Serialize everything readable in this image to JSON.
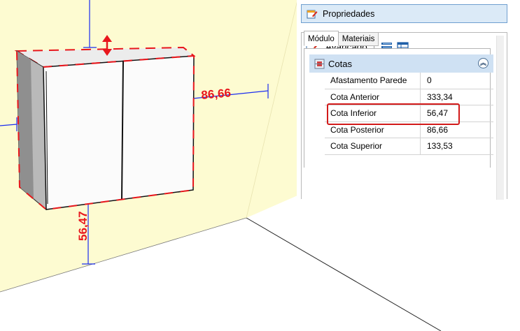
{
  "viewport": {
    "dimensions": {
      "right": "86,66",
      "bottom": "56,47"
    },
    "colors": {
      "wall": "#fdfbd1",
      "dimension_red": "#e8161c",
      "dimension_blue": "#1a2cf0"
    }
  },
  "panel": {
    "header_title": "Propriedades",
    "header_icon": "properties-icon",
    "advanced_label": "Avançado",
    "tabs": [
      {
        "label": "Módulo",
        "active": true
      },
      {
        "label": "Materiais",
        "active": false
      }
    ],
    "group": {
      "label": "Cotas",
      "collapse_glyph": "︽"
    },
    "rows": [
      {
        "name": "Afastamento Parede",
        "value": "0",
        "highlighted": true
      },
      {
        "name": "Cota Anterior",
        "value": "333,34"
      },
      {
        "name": "Cota Inferior",
        "value": "56,47"
      },
      {
        "name": "Cota Posterior",
        "value": "86,66"
      },
      {
        "name": "Cota Superior",
        "value": "133,53"
      }
    ],
    "colors": {
      "header_bg": "#dbeaf7",
      "group_bg": "#cfe1f3",
      "highlight": "#d21a1a"
    }
  }
}
